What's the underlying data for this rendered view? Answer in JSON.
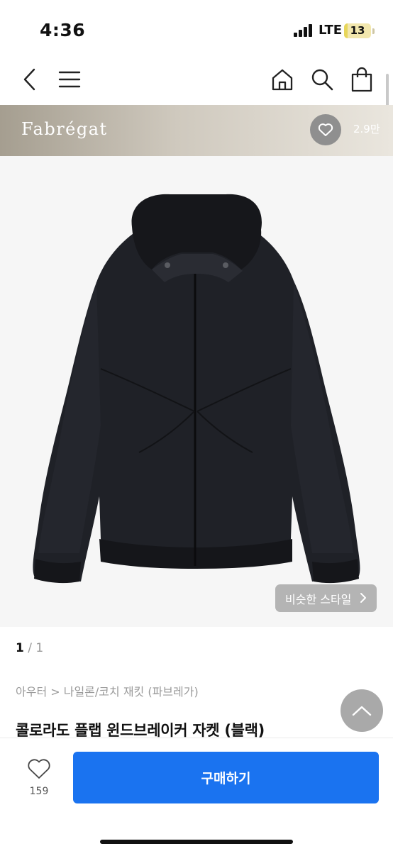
{
  "status_bar": {
    "time": "4:36",
    "network": "LTE",
    "battery": "13",
    "battery_level": 0.13
  },
  "top_nav": {
    "back_icon": "chevron-left-icon",
    "menu_icon": "hamburger-menu-icon",
    "home_icon": "home-icon",
    "search_icon": "search-icon",
    "cart_icon": "shopping-bag-icon"
  },
  "brand": {
    "name": "Fabrégat",
    "likes": "2.9만"
  },
  "image": {
    "similar_style_label": "비슷한 스타일"
  },
  "gallery": {
    "current": "1",
    "separator": " / ",
    "total": "1"
  },
  "product": {
    "category": "아우터 > 나일론/코치 재킷 (파브레가)",
    "title": "콜로라도 플랩 윈드브레이커 자켓 (블랙)"
  },
  "bottom_bar": {
    "wish_count": "159",
    "buy_label": "구매하기"
  },
  "colors": {
    "accent": "#1a73f0",
    "brand_bar": "#cfc9be"
  }
}
